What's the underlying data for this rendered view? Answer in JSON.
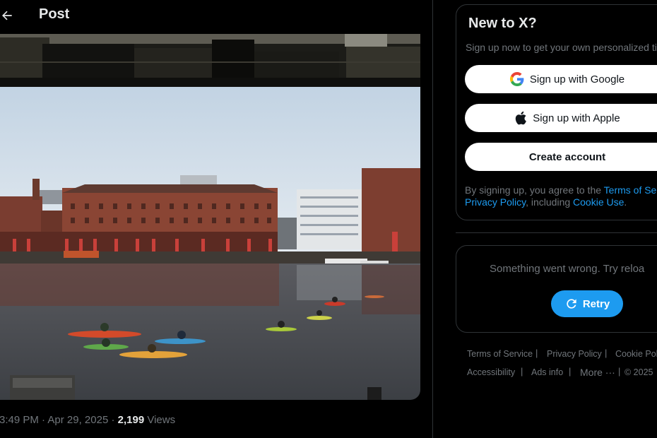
{
  "header": {
    "title": "Post",
    "back_icon": "arrow-left-icon"
  },
  "post_meta": {
    "time": "3:49 PM",
    "date": "Apr 29, 2025",
    "dot": "·",
    "views_count": "2,199",
    "views_label": "Views"
  },
  "signup": {
    "title": "New to X?",
    "subtitle": "Sign up now to get your own personalized ti",
    "google_label": "Sign up with Google",
    "apple_label": "Sign up with Apple",
    "create_label": "Create account",
    "terms_prefix": "By signing up, you agree to the ",
    "terms_link": "Terms of Ser",
    "privacy_link": "Privacy Policy",
    "terms_mid": ", including ",
    "cookie_link": "Cookie Use",
    "terms_end": "."
  },
  "error": {
    "message": "Something went wrong. Try reloa",
    "retry_label": "Retry"
  },
  "footer": {
    "row1": [
      "Terms of Service",
      "Privacy Policy",
      "Cookie Poli"
    ],
    "row2": [
      "Accessibility",
      "Ads info",
      "More ···",
      "© 2025"
    ],
    "separator": "|"
  },
  "colors": {
    "accent": "#1d9bf0",
    "background": "#000000",
    "border": "#2f3336",
    "muted_text": "#71767b"
  }
}
